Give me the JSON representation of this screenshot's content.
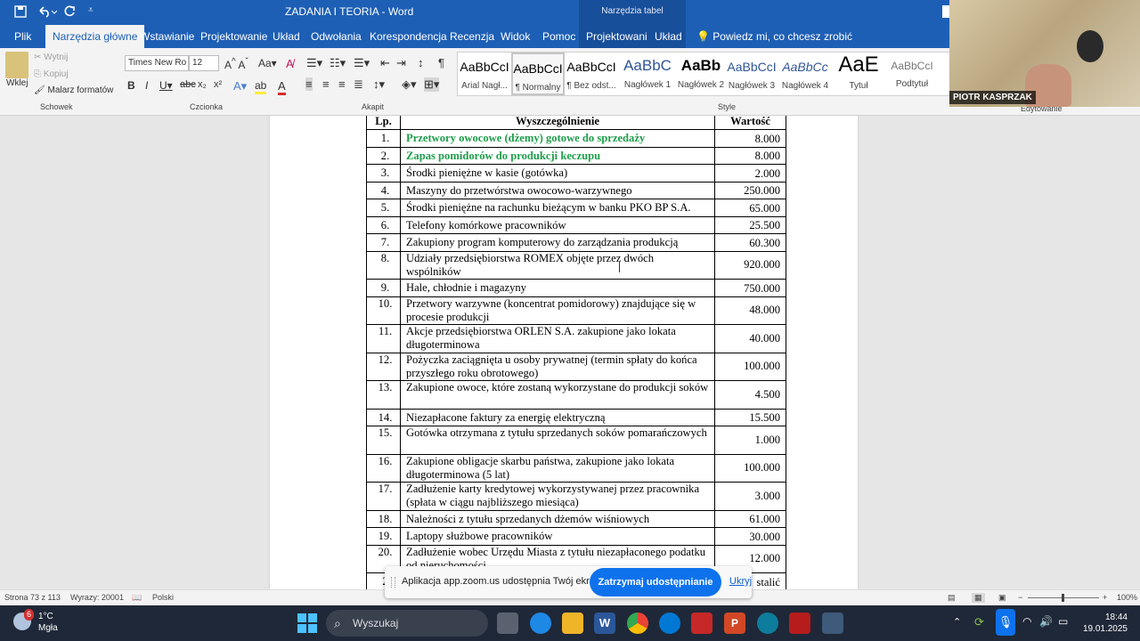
{
  "window": {
    "title": "ZADANIA I TEORIA",
    "app": "Word",
    "context_tools": "Narzędzia tabel"
  },
  "tabs": [
    "Plik",
    "Narzędzia główne",
    "Wstawianie",
    "Projektowanie",
    "Układ",
    "Odwołania",
    "Korespondencja",
    "Recenzja",
    "Widok",
    "Pomoc"
  ],
  "context_tabs": [
    "Projektowanie",
    "Układ"
  ],
  "tell_me": "Powiedz mi, co chcesz zrobić",
  "ribbon": {
    "clipboard": {
      "label": "Schowek",
      "paste": "Wklej",
      "cut": "Wytnij",
      "copy": "Kopiuj",
      "painter": "Malarz formatów"
    },
    "font": {
      "label": "Czcionka",
      "name": "Times New Ro",
      "size": "12"
    },
    "paragraph": {
      "label": "Akapit"
    },
    "styles": {
      "label": "Style",
      "items": [
        {
          "preview": "AaBbCcI",
          "name": "Arial Nagł..."
        },
        {
          "preview": "AaBbCcI",
          "name": "¶ Normalny"
        },
        {
          "preview": "AaBbCcI",
          "name": "¶ Bez odst..."
        },
        {
          "preview": "AaBbC",
          "name": "Nagłówek 1"
        },
        {
          "preview": "AaBb",
          "name": "Nagłówek 2"
        },
        {
          "preview": "AaBbCcI",
          "name": "Nagłówek 3"
        },
        {
          "preview": "AaBbCc",
          "name": "Nagłówek 4"
        },
        {
          "preview": "AaE",
          "name": "Tytuł"
        },
        {
          "preview": "AaBbCcI",
          "name": "Podtytuł"
        }
      ]
    },
    "editing": {
      "label": "Edytowanie"
    }
  },
  "table": {
    "headers": {
      "lp": "Lp.",
      "desc": "Wyszczególnienie",
      "val": "Wartość"
    },
    "rows": [
      {
        "lp": "1.",
        "desc": "Przetwory owocowe (dżemy) gotowe do sprzedaży",
        "val": "8.000",
        "green": true
      },
      {
        "lp": "2.",
        "desc": "Zapas pomidorów do produkcji keczupu",
        "val": "8.000",
        "green": true
      },
      {
        "lp": "3.",
        "desc": "Środki pieniężne w kasie (gotówka)",
        "val": "2.000"
      },
      {
        "lp": "4.",
        "desc": "Maszyny do przetwórstwa owocowo-warzywnego",
        "val": "250.000"
      },
      {
        "lp": "5.",
        "desc": "Środki pieniężne na rachunku bieżącym w banku PKO BP S.A.",
        "val": "65.000"
      },
      {
        "lp": "6.",
        "desc": "Telefony komórkowe pracowników",
        "val": "25.500"
      },
      {
        "lp": "7.",
        "desc": "Zakupiony program komputerowy do zarządzania produkcją",
        "val": "60.300"
      },
      {
        "lp": "8.",
        "desc": "Udziały przedsiębiorstwa ROMEX objęte przez dwóch wspólników",
        "val": "920.000",
        "tall": true
      },
      {
        "lp": "9.",
        "desc": "Hale, chłodnie i magazyny",
        "val": "750.000"
      },
      {
        "lp": "10.",
        "desc": "Przetwory warzywne (koncentrat pomidorowy) znajdujące się w procesie produkcji",
        "val": "48.000",
        "tall": true
      },
      {
        "lp": "11.",
        "desc": "Akcje przedsiębiorstwa ORLEN S.A. zakupione jako lokata długoterminowa",
        "val": "40.000",
        "tall": true
      },
      {
        "lp": "12.",
        "desc": "Pożyczka zaciągnięta u osoby prywatnej (termin spłaty do końca przyszłego roku obrotowego)",
        "val": "100.000",
        "tall": true
      },
      {
        "lp": "13.",
        "desc": "Zakupione owoce, które zostaną wykorzystane do produkcji soków",
        "val": "4.500",
        "tall": true
      },
      {
        "lp": "14.",
        "desc": "Niezapłacone faktury za energię elektryczną",
        "val": "15.500"
      },
      {
        "lp": "15.",
        "desc": "Gotówka otrzymana z tytułu sprzedanych soków pomarańczowych",
        "val": "1.000",
        "tall": true
      },
      {
        "lp": "16.",
        "desc": "Zakupione obligacje skarbu państwa, zakupione jako lokata długoterminowa (5 lat)",
        "val": "100.000",
        "tall": true
      },
      {
        "lp": "17.",
        "desc": "Zadłużenie karty kredytowej wykorzystywanej przez pracownika (spłata w ciągu najbliższego miesiąca)",
        "val": "3.000",
        "tall": true
      },
      {
        "lp": "18.",
        "desc": "Należności z tytułu sprzedanych dżemów wiśniowych",
        "val": "61.000"
      },
      {
        "lp": "19.",
        "desc": "Laptopy służbowe pracowników",
        "val": "30.000"
      },
      {
        "lp": "20.",
        "desc": "Zadłużenie wobec Urzędu Miasta z tytułu niezapłaconego podatku od nieruchomości",
        "val": "12.000",
        "tall": true
      },
      {
        "lp": "2",
        "desc": "",
        "val": "stalić"
      }
    ]
  },
  "status": {
    "page": "Strona 73 z 113",
    "words": "Wyrazy: 20001",
    "language": "Polski",
    "zoom": "100%"
  },
  "zoom_share": {
    "message": "Aplikacja app.zoom.us udostępnia Twój ekran.",
    "stop": "Zatrzymaj udostępnianie",
    "hide": "Ukryj"
  },
  "video": {
    "participant": "PIOTR KASPRZAK"
  },
  "taskbar": {
    "temp": "1°C",
    "weather": "Mgła",
    "search": "Wyszukaj",
    "time": "18:44",
    "date": "19.01.2025",
    "badge": "6"
  }
}
